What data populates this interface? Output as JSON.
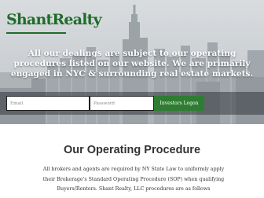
{
  "logo": {
    "text": "ShantRealty"
  },
  "hero": {
    "tagline": "All our dealings are subject to our operating procedures listed on our website. We are primarily engaged in NYC & surrounding real estate markets."
  },
  "login_form": {
    "email_placeholder": "Email",
    "password_placeholder": "Password",
    "button_label": "Investors Logon"
  },
  "section": {
    "title": "Our Operating Procedure",
    "body": "All brokers and agents are required by NY State Law to uniformly apply their Brokerage's Standard Operating Procedure (SOP) when qualifying Buyers/Renters. Shant Realty, LLC procedures are as follows"
  },
  "colors": {
    "brand_green": "#1f6b2a",
    "button_green": "#2e7d32",
    "heading": "#333333"
  }
}
